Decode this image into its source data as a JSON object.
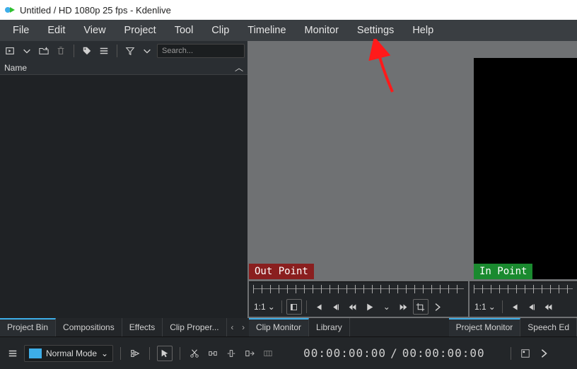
{
  "title": "Untitled / HD 1080p 25 fps - Kdenlive",
  "menu": [
    "File",
    "Edit",
    "View",
    "Project",
    "Tool",
    "Clip",
    "Timeline",
    "Monitor",
    "Settings",
    "Help"
  ],
  "bin": {
    "search_placeholder": "Search...",
    "header_col": "Name"
  },
  "clip_monitor": {
    "out_label": "Out Point",
    "zoom": "1:1"
  },
  "project_monitor": {
    "in_label": "In Point",
    "zoom": "1:1"
  },
  "tabs_left": {
    "items": [
      "Project Bin",
      "Compositions",
      "Effects",
      "Clip Proper..."
    ],
    "active": 0
  },
  "tabs_mid": {
    "items": [
      "Clip Monitor",
      "Library"
    ],
    "active": 0
  },
  "tabs_right": {
    "items": [
      "Project Monitor",
      "Speech Ed"
    ],
    "active": 0
  },
  "timeline": {
    "mode": "Normal Mode",
    "pos": "00:00:00:00",
    "sep": "/",
    "dur": "00:00:00:00"
  }
}
